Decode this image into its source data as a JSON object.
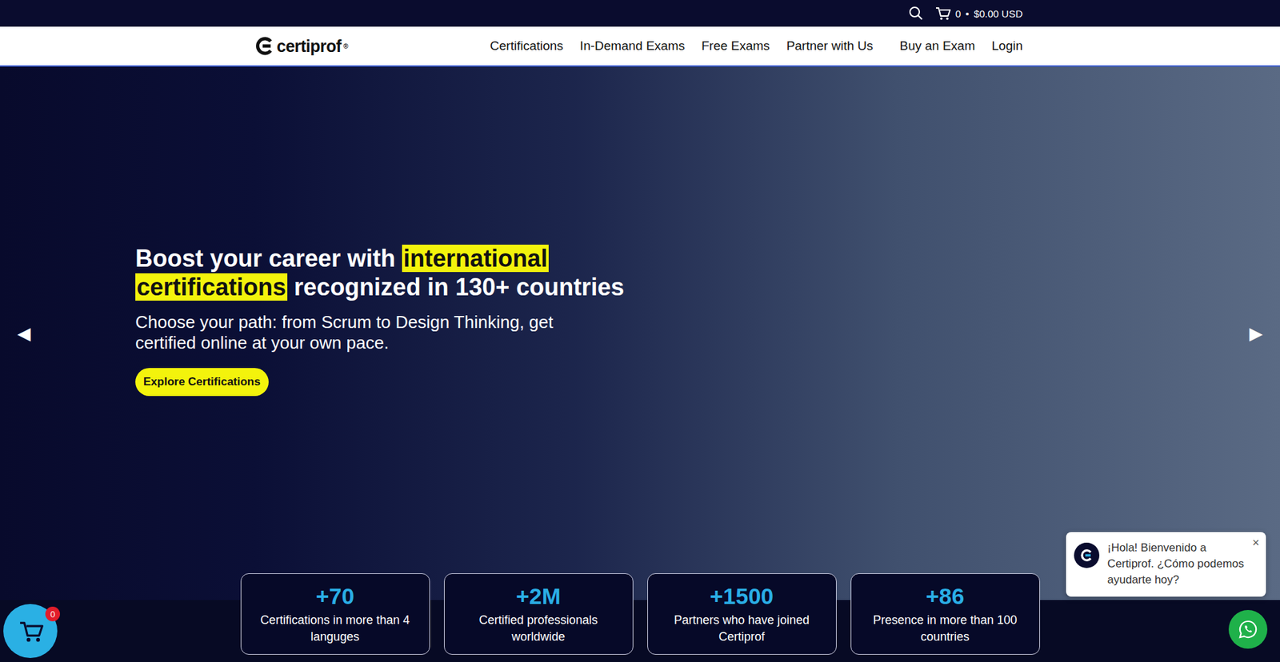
{
  "topbar": {
    "cart_count": "0",
    "separator": "•",
    "cart_total": "$0.00 USD"
  },
  "logo": {
    "text": "certiprof",
    "mark": "®"
  },
  "nav": [
    "Certifications",
    "In-Demand Exams",
    "Free Exams",
    "Partner with Us",
    "Buy an Exam",
    "Login"
  ],
  "hero": {
    "headline_before": "Boost your career with ",
    "headline_highlight": "international certifications",
    "headline_after": " recognized in 130+ countries",
    "subtitle": "Choose your path: from Scrum to Design Thinking, get certified online at your own pace.",
    "cta": "Explore Certifications",
    "prev": "◀",
    "next": "▶"
  },
  "stats": [
    {
      "value": "+70",
      "label": "Certifications in more than 4 languges"
    },
    {
      "value": "+2M",
      "label": "Certified professionals worldwide"
    },
    {
      "value": "+1500",
      "label": "Partners who have joined Certiprof"
    },
    {
      "value": "+86",
      "label": "Presence in more than 100 countries"
    }
  ],
  "chat": {
    "message": "¡Hola! Bienvenido a Certiprof. ¿Cómo podemos ayudarte hoy?",
    "close": "×"
  },
  "floating_cart": {
    "badge": "0"
  }
}
